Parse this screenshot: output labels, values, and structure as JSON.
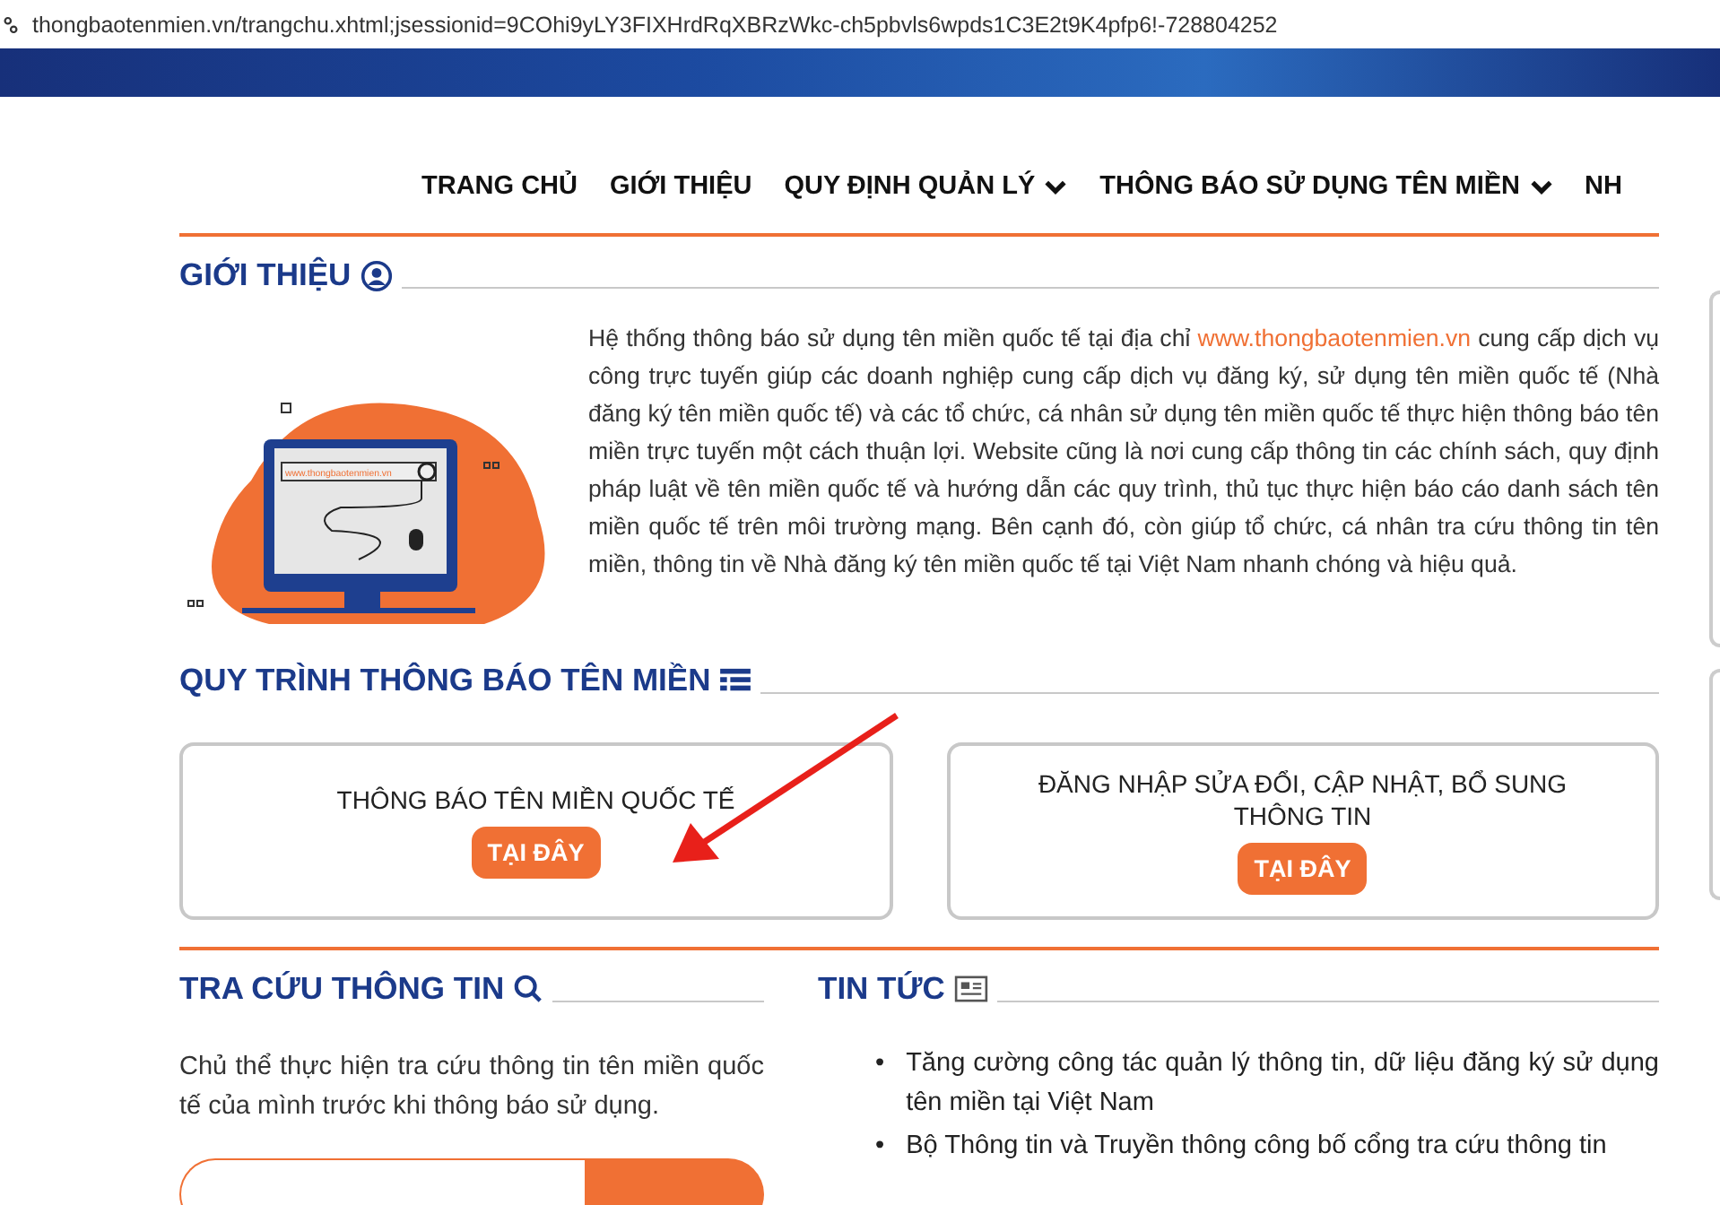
{
  "address_bar": {
    "url": "thongbaotenmien.vn/trangchu.xhtml;jsessionid=9COhi9yLY3FIXHrdRqXBRzWkc-ch5pbvls6wpds1C3E2t9K4pfp6!-728804252"
  },
  "nav": [
    {
      "label": "TRANG CHỦ",
      "dropdown": false
    },
    {
      "label": "GIỚI THIỆU",
      "dropdown": false
    },
    {
      "label": "QUY ĐỊNH QUẢN LÝ",
      "dropdown": true
    },
    {
      "label": "THÔNG BÁO SỬ DỤNG TÊN MIỀN",
      "dropdown": true
    },
    {
      "label": "NH",
      "dropdown": false
    }
  ],
  "intro": {
    "title": "GIỚI THIỆU",
    "illustration_url": "www.thongbaotenmien.vn",
    "text_before": "Hệ thống thông báo sử dụng tên miền quốc tế tại địa chỉ ",
    "link": "www.thongbaotenmien.vn",
    "text_after": " cung cấp dịch vụ công trực tuyến giúp các doanh nghiệp cung cấp dịch vụ đăng ký, sử dụng tên miền quốc tế (Nhà đăng ký tên miền quốc tế) và các tổ chức, cá nhân sử dụng tên miền quốc tế thực hiện thông báo tên miền trực tuyến một cách thuận lợi. Website cũng là nơi cung cấp thông tin các chính sách, quy định pháp luật về tên miền quốc tế và hướng dẫn các quy trình, thủ tục thực hiện báo cáo danh sách tên miền quốc tế trên môi trường mạng. Bên cạnh đó, còn giúp tổ chức, cá nhân tra cứu thông tin tên miền, thông tin về Nhà đăng ký tên miền quốc tế tại Việt Nam nhanh chóng và hiệu quả."
  },
  "process": {
    "title": "QUY TRÌNH THÔNG BÁO TÊN MIỀN",
    "cards": [
      {
        "title": "THÔNG BÁO TÊN MIỀN QUỐC TẾ",
        "button": "TẠI ĐÂY"
      },
      {
        "title": "ĐĂNG NHẬP SỬA ĐỔI, CẬP NHẬT, BỔ SUNG THÔNG TIN",
        "button": "TẠI ĐÂY"
      }
    ]
  },
  "lookup": {
    "title": "TRA CỨU THÔNG TIN",
    "description": "Chủ thể thực hiện tra cứu thông tin tên miền quốc tế của mình trước khi thông báo sử dụng."
  },
  "news": {
    "title": "TIN TỨC",
    "items": [
      {
        "bullet": "•",
        "text": "Tăng cường công tác quản lý thông tin, dữ liệu đăng ký sử dụng tên miền tại Việt Nam"
      },
      {
        "bullet": "•",
        "text": "Bộ Thông tin và Truyền thông công bố cổng tra cứu thông tin"
      }
    ]
  }
}
